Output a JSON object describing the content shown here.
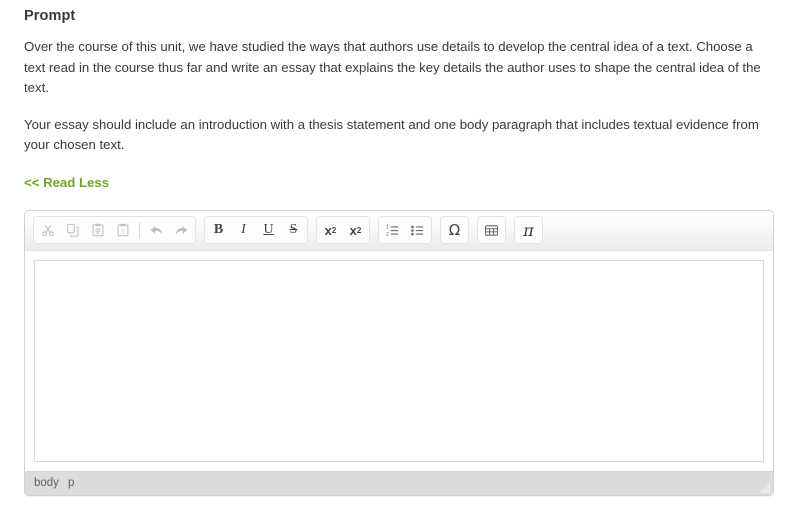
{
  "prompt": {
    "heading": "Prompt",
    "paragraph1": "Over the course of this unit, we have studied the ways that authors use details to develop the central idea of a text. Choose a text read in the course thus far and write an essay that explains the key details the author uses to shape the central idea of the text.",
    "paragraph2": "Your essay should include an introduction with a thesis statement and one body paragraph that includes textual evidence from your chosen text.",
    "read_less_label": "<< Read Less",
    "link_color": "#6fa52e",
    "heading_color": "#2e3d49"
  },
  "editor": {
    "content": "",
    "placeholder": "",
    "toolbar": {
      "groups": [
        {
          "name": "clipboard-history",
          "buttons": [
            {
              "name": "cut-icon",
              "label": "Cut",
              "glyph": "✂",
              "disabled": true
            },
            {
              "name": "copy-icon",
              "label": "Copy",
              "glyph": "copy",
              "disabled": true
            },
            {
              "name": "paste-icon",
              "label": "Paste",
              "glyph": "paste",
              "disabled": true
            },
            {
              "name": "paste-as-text-icon",
              "label": "Paste as plain text",
              "glyph": "paste-text",
              "disabled": true
            },
            {
              "name": "separator",
              "label": "",
              "glyph": "sep",
              "disabled": false
            },
            {
              "name": "undo-icon",
              "label": "Undo",
              "glyph": "undo",
              "disabled": true
            },
            {
              "name": "redo-icon",
              "label": "Redo",
              "glyph": "redo",
              "disabled": true
            }
          ]
        },
        {
          "name": "text-style",
          "buttons": [
            {
              "name": "bold-icon",
              "label": "B",
              "glyph": "bold",
              "disabled": false
            },
            {
              "name": "italic-icon",
              "label": "I",
              "glyph": "italic",
              "disabled": false
            },
            {
              "name": "underline-icon",
              "label": "U",
              "glyph": "underline",
              "disabled": false
            },
            {
              "name": "strikethrough-icon",
              "label": "S",
              "glyph": "strike",
              "disabled": false
            }
          ]
        },
        {
          "name": "script",
          "buttons": [
            {
              "name": "subscript-icon",
              "label": "x2",
              "glyph": "sub",
              "disabled": false
            },
            {
              "name": "superscript-icon",
              "label": "x2",
              "glyph": "sup",
              "disabled": false
            }
          ]
        },
        {
          "name": "lists",
          "buttons": [
            {
              "name": "numbered-list-icon",
              "label": "Insert/Remove Numbered List",
              "glyph": "ol",
              "disabled": false
            },
            {
              "name": "bulleted-list-icon",
              "label": "Insert/Remove Bulleted List",
              "glyph": "ul",
              "disabled": false
            }
          ]
        },
        {
          "name": "special-character",
          "buttons": [
            {
              "name": "omega-icon",
              "label": "Ω",
              "glyph": "omega",
              "disabled": false
            }
          ]
        },
        {
          "name": "table",
          "buttons": [
            {
              "name": "table-icon",
              "label": "Table",
              "glyph": "table",
              "disabled": false
            }
          ]
        },
        {
          "name": "math",
          "buttons": [
            {
              "name": "pi-math-icon",
              "label": "π",
              "glyph": "pi",
              "disabled": false
            }
          ]
        }
      ]
    },
    "status_path": [
      {
        "label": "body"
      },
      {
        "label": "p"
      }
    ]
  }
}
